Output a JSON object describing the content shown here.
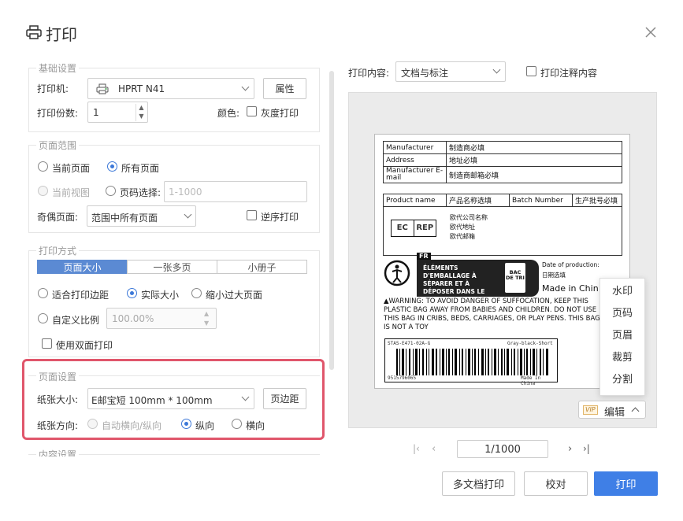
{
  "dialog": {
    "title": "打印"
  },
  "basic": {
    "title": "基础设置",
    "printer_label": "打印机:",
    "printer_value": "HPRT N41",
    "properties_btn": "属性",
    "copies_label": "打印份数:",
    "copies_value": "1",
    "color_label": "颜色:",
    "grayscale_label": "灰度打印"
  },
  "range": {
    "title": "页面范围",
    "current_page": "当前页面",
    "all_pages": "所有页面",
    "current_view": "当前视图",
    "page_select": "页码选择:",
    "page_select_placeholder": "1-1000",
    "odd_even_label": "奇偶页面:",
    "odd_even_value": "范围中所有页面",
    "reverse": "逆序打印"
  },
  "mode": {
    "title": "打印方式",
    "tabs": [
      "页面大小",
      "一张多页",
      "小册子"
    ],
    "fit_margin": "适合打印边距",
    "actual_size": "实际大小",
    "shrink": "缩小过大页面",
    "custom_scale": "自定义比例",
    "scale_value": "100.00%",
    "duplex": "使用双面打印"
  },
  "page_setup": {
    "title": "页面设置",
    "paper_size_label": "纸张大小:",
    "paper_size_value": "E邮宝短 100mm * 100mm",
    "margin_btn": "页边距",
    "orientation_label": "纸张方向:",
    "auto": "自动横向/纵向",
    "portrait": "纵向",
    "landscape": "横向"
  },
  "content_setup": {
    "title": "内容设置"
  },
  "preview": {
    "content_label": "打印内容:",
    "content_value": "文档与标注",
    "annotations": "打印注释内容",
    "page": "1/1000",
    "edit": "编辑",
    "vip": "VIP"
  },
  "context_menu": [
    "水印",
    "页码",
    "页眉",
    "裁剪",
    "分割"
  ],
  "label": {
    "rows": [
      [
        "Manufacturer",
        "制造商必填"
      ],
      [
        "Address",
        "地址必填"
      ],
      [
        "Manufacturer E-mail",
        "制造商邮箱必填"
      ]
    ],
    "product_name": "Product name",
    "product_value": "产品名称选填",
    "batch": "Batch Number",
    "batch_value": "生产批号必填",
    "ec": "EC",
    "rep": "REP",
    "rep_lines": [
      "欧代公司名称",
      "欧代地址",
      "欧代邮箱"
    ],
    "fr": "FR",
    "recycle_text": "ÉLÉMENTS D'EMBALLAGE À SÉPARER ET À DÉPOSER DANS LE BAC DE TRI",
    "bac": "BAC DE TRI",
    "date_prod": "Date of production:",
    "date_value": "日期选填",
    "made_in": "Made in China",
    "warning": "▲WARNING: TO AVOID DANGER OF SUFFOCATION, KEEP THIS PLASTIC BAG AWAY FROM BABIES AND CHILDREN. DO NOT USE THIS BAG IN CRIBS, BEDS, CARRIAGES, OR PLAY PENS. THIS BAG IS NOT A TOY",
    "sku": "STAS-E471-02A-G",
    "variant": "Gray-black-Short",
    "barcode_num": "9515796065",
    "barcode_made": "Made In China"
  },
  "footer": {
    "multi": "多文档打印",
    "proof": "校对",
    "print": "打印"
  }
}
